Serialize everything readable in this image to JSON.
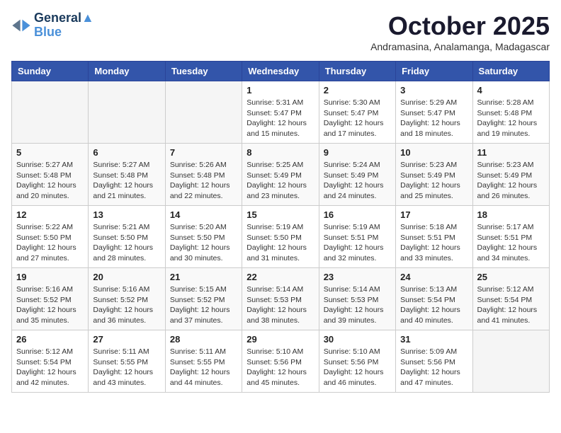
{
  "header": {
    "logo_line1": "General",
    "logo_line2": "Blue",
    "month_year": "October 2025",
    "location": "Andramasina, Analamanga, Madagascar"
  },
  "days_of_week": [
    "Sunday",
    "Monday",
    "Tuesday",
    "Wednesday",
    "Thursday",
    "Friday",
    "Saturday"
  ],
  "weeks": [
    [
      {
        "day": "",
        "info": ""
      },
      {
        "day": "",
        "info": ""
      },
      {
        "day": "",
        "info": ""
      },
      {
        "day": "1",
        "info": "Sunrise: 5:31 AM\nSunset: 5:47 PM\nDaylight: 12 hours and 15 minutes."
      },
      {
        "day": "2",
        "info": "Sunrise: 5:30 AM\nSunset: 5:47 PM\nDaylight: 12 hours and 17 minutes."
      },
      {
        "day": "3",
        "info": "Sunrise: 5:29 AM\nSunset: 5:47 PM\nDaylight: 12 hours and 18 minutes."
      },
      {
        "day": "4",
        "info": "Sunrise: 5:28 AM\nSunset: 5:48 PM\nDaylight: 12 hours and 19 minutes."
      }
    ],
    [
      {
        "day": "5",
        "info": "Sunrise: 5:27 AM\nSunset: 5:48 PM\nDaylight: 12 hours and 20 minutes."
      },
      {
        "day": "6",
        "info": "Sunrise: 5:27 AM\nSunset: 5:48 PM\nDaylight: 12 hours and 21 minutes."
      },
      {
        "day": "7",
        "info": "Sunrise: 5:26 AM\nSunset: 5:48 PM\nDaylight: 12 hours and 22 minutes."
      },
      {
        "day": "8",
        "info": "Sunrise: 5:25 AM\nSunset: 5:49 PM\nDaylight: 12 hours and 23 minutes."
      },
      {
        "day": "9",
        "info": "Sunrise: 5:24 AM\nSunset: 5:49 PM\nDaylight: 12 hours and 24 minutes."
      },
      {
        "day": "10",
        "info": "Sunrise: 5:23 AM\nSunset: 5:49 PM\nDaylight: 12 hours and 25 minutes."
      },
      {
        "day": "11",
        "info": "Sunrise: 5:23 AM\nSunset: 5:49 PM\nDaylight: 12 hours and 26 minutes."
      }
    ],
    [
      {
        "day": "12",
        "info": "Sunrise: 5:22 AM\nSunset: 5:50 PM\nDaylight: 12 hours and 27 minutes."
      },
      {
        "day": "13",
        "info": "Sunrise: 5:21 AM\nSunset: 5:50 PM\nDaylight: 12 hours and 28 minutes."
      },
      {
        "day": "14",
        "info": "Sunrise: 5:20 AM\nSunset: 5:50 PM\nDaylight: 12 hours and 30 minutes."
      },
      {
        "day": "15",
        "info": "Sunrise: 5:19 AM\nSunset: 5:50 PM\nDaylight: 12 hours and 31 minutes."
      },
      {
        "day": "16",
        "info": "Sunrise: 5:19 AM\nSunset: 5:51 PM\nDaylight: 12 hours and 32 minutes."
      },
      {
        "day": "17",
        "info": "Sunrise: 5:18 AM\nSunset: 5:51 PM\nDaylight: 12 hours and 33 minutes."
      },
      {
        "day": "18",
        "info": "Sunrise: 5:17 AM\nSunset: 5:51 PM\nDaylight: 12 hours and 34 minutes."
      }
    ],
    [
      {
        "day": "19",
        "info": "Sunrise: 5:16 AM\nSunset: 5:52 PM\nDaylight: 12 hours and 35 minutes."
      },
      {
        "day": "20",
        "info": "Sunrise: 5:16 AM\nSunset: 5:52 PM\nDaylight: 12 hours and 36 minutes."
      },
      {
        "day": "21",
        "info": "Sunrise: 5:15 AM\nSunset: 5:52 PM\nDaylight: 12 hours and 37 minutes."
      },
      {
        "day": "22",
        "info": "Sunrise: 5:14 AM\nSunset: 5:53 PM\nDaylight: 12 hours and 38 minutes."
      },
      {
        "day": "23",
        "info": "Sunrise: 5:14 AM\nSunset: 5:53 PM\nDaylight: 12 hours and 39 minutes."
      },
      {
        "day": "24",
        "info": "Sunrise: 5:13 AM\nSunset: 5:54 PM\nDaylight: 12 hours and 40 minutes."
      },
      {
        "day": "25",
        "info": "Sunrise: 5:12 AM\nSunset: 5:54 PM\nDaylight: 12 hours and 41 minutes."
      }
    ],
    [
      {
        "day": "26",
        "info": "Sunrise: 5:12 AM\nSunset: 5:54 PM\nDaylight: 12 hours and 42 minutes."
      },
      {
        "day": "27",
        "info": "Sunrise: 5:11 AM\nSunset: 5:55 PM\nDaylight: 12 hours and 43 minutes."
      },
      {
        "day": "28",
        "info": "Sunrise: 5:11 AM\nSunset: 5:55 PM\nDaylight: 12 hours and 44 minutes."
      },
      {
        "day": "29",
        "info": "Sunrise: 5:10 AM\nSunset: 5:56 PM\nDaylight: 12 hours and 45 minutes."
      },
      {
        "day": "30",
        "info": "Sunrise: 5:10 AM\nSunset: 5:56 PM\nDaylight: 12 hours and 46 minutes."
      },
      {
        "day": "31",
        "info": "Sunrise: 5:09 AM\nSunset: 5:56 PM\nDaylight: 12 hours and 47 minutes."
      },
      {
        "day": "",
        "info": ""
      }
    ]
  ]
}
